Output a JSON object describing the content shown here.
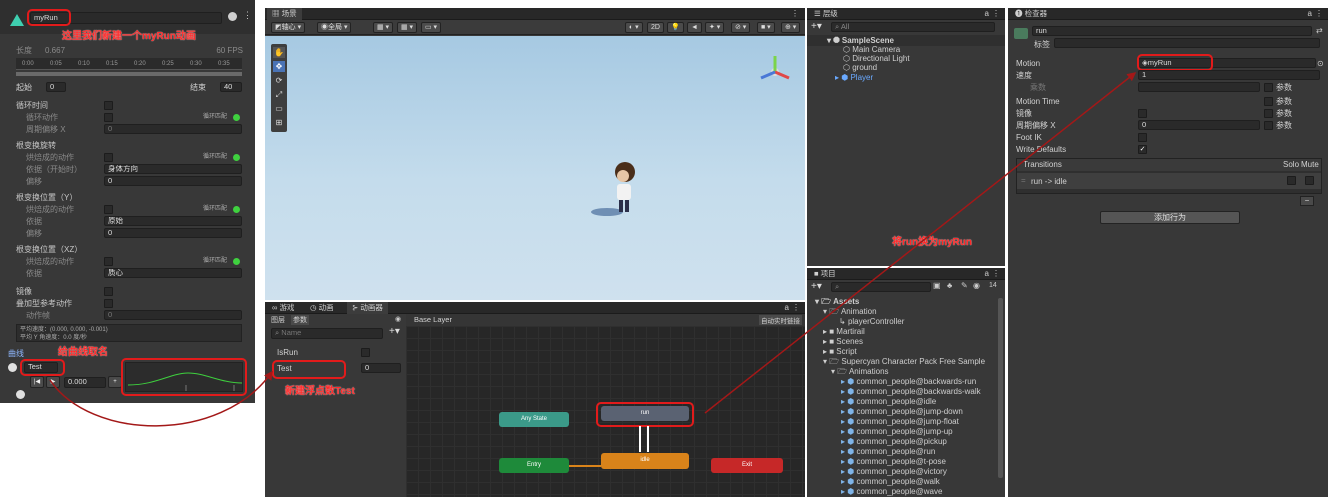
{
  "clip_panel": {
    "clip_name": "myRun",
    "length_label": "长度",
    "length_value": "0.667",
    "fps_label": "60 FPS",
    "ruler": [
      "0:00",
      "0:05",
      "0:10",
      "0:15",
      "0:20",
      "0:25",
      "0:30",
      "0:35"
    ],
    "start_label": "起始",
    "start_value": "0",
    "end_label": "结束",
    "end_value": "40",
    "loop_time": "循环时间",
    "loop_pose": "循环动作",
    "cycle_offset": "周期偏移 X",
    "cycle_offset_value": "0",
    "loop_match": "循环匹配",
    "root_rot": "根变换旋转",
    "bake_pose": "烘焙成的动作",
    "based_on_start": "依据（开始时）",
    "based_on_start_value": "身体方向",
    "offset": "偏移",
    "offset_value": "0",
    "root_pos_y": "根变换位置（Y）",
    "based_on": "依据",
    "based_on_y_value": "原始",
    "offset_y_value": "0",
    "root_pos_xz": "根变换位置（XZ）",
    "based_on_xz_value": "质心",
    "mirror": "镜像",
    "additive": "叠加型参考动作",
    "pose_frame": "动作帧",
    "pose_frame_value": "0",
    "avg1": "平均速度：(0.000, 0.000, -0.001)",
    "avg2": "平均 Y 角速度：0.0 度/秒",
    "curves": "曲线",
    "curve_name": "Test",
    "curve_value": "0.000",
    "annotation_top": "这里我们新建一个myRun动画",
    "annotation_curve": "给曲线取名"
  },
  "scene_panel": {
    "tab": "场景",
    "toolbar": [
      "轴心",
      "全局"
    ],
    "toolbar_2d": "2D"
  },
  "animator_panel": {
    "tabs": [
      "游戏",
      "动画",
      "动画器"
    ],
    "sub_tabs": [
      "图层",
      "参数"
    ],
    "layer": "Base Layer",
    "auto_link": "自动实时链接",
    "search_placeholder": "Name",
    "params": [
      {
        "name": "IsRun",
        "value": ""
      },
      {
        "name": "Test",
        "value": "0"
      }
    ],
    "nodes": {
      "any": "Any State",
      "run": "run",
      "entry": "Entry",
      "idle": "idle",
      "exit": "Exit"
    },
    "annotation_param": "新建浮点数Test"
  },
  "hierarchy_panel": {
    "tab": "层级",
    "search_placeholder": "All",
    "scene": "SampleScene",
    "items": [
      "Main Camera",
      "Directional Light",
      "ground",
      "Player"
    ]
  },
  "project_panel": {
    "tab": "项目",
    "count": "14",
    "tree": [
      "Assets",
      "Animation",
      "playerController",
      "Martirail",
      "Scenes",
      "Script",
      "Supercyan Character Pack Free Sample",
      "Animations",
      "common_people@backwards-run",
      "common_people@backwards-walk",
      "common_people@idle",
      "common_people@jump-down",
      "common_people@jump-float",
      "common_people@jump-up",
      "common_people@pickup",
      "common_people@run",
      "common_people@t-pose",
      "common_people@victory",
      "common_people@walk",
      "common_people@wave"
    ]
  },
  "inspector_panel": {
    "tab": "检查器",
    "name": "run",
    "tag_label": "标签",
    "motion_label": "Motion",
    "motion_value": "myRun",
    "speed_label": "速度",
    "speed_value": "1",
    "multiplier_label": "乘数",
    "param_label": "参数",
    "motion_time": "Motion Time",
    "mirror": "镜像",
    "cycle_offset": "周期偏移 X",
    "cycle_offset_value": "0",
    "foot_ik": "Foot IK",
    "write_defaults": "Write Defaults",
    "transitions": "Transitions",
    "solo": "Solo",
    "mute": "Mute",
    "transition_item": "run -> idle",
    "add_behaviour": "添加行为",
    "annotation_replace": "将run换为myRun"
  },
  "colors": {
    "accent_red": "#e21b1b",
    "any_state": "#3a9a8a",
    "entry": "#1f8a3a",
    "idle": "#d9831a",
    "exit": "#c62828",
    "run": "#5b6270"
  }
}
